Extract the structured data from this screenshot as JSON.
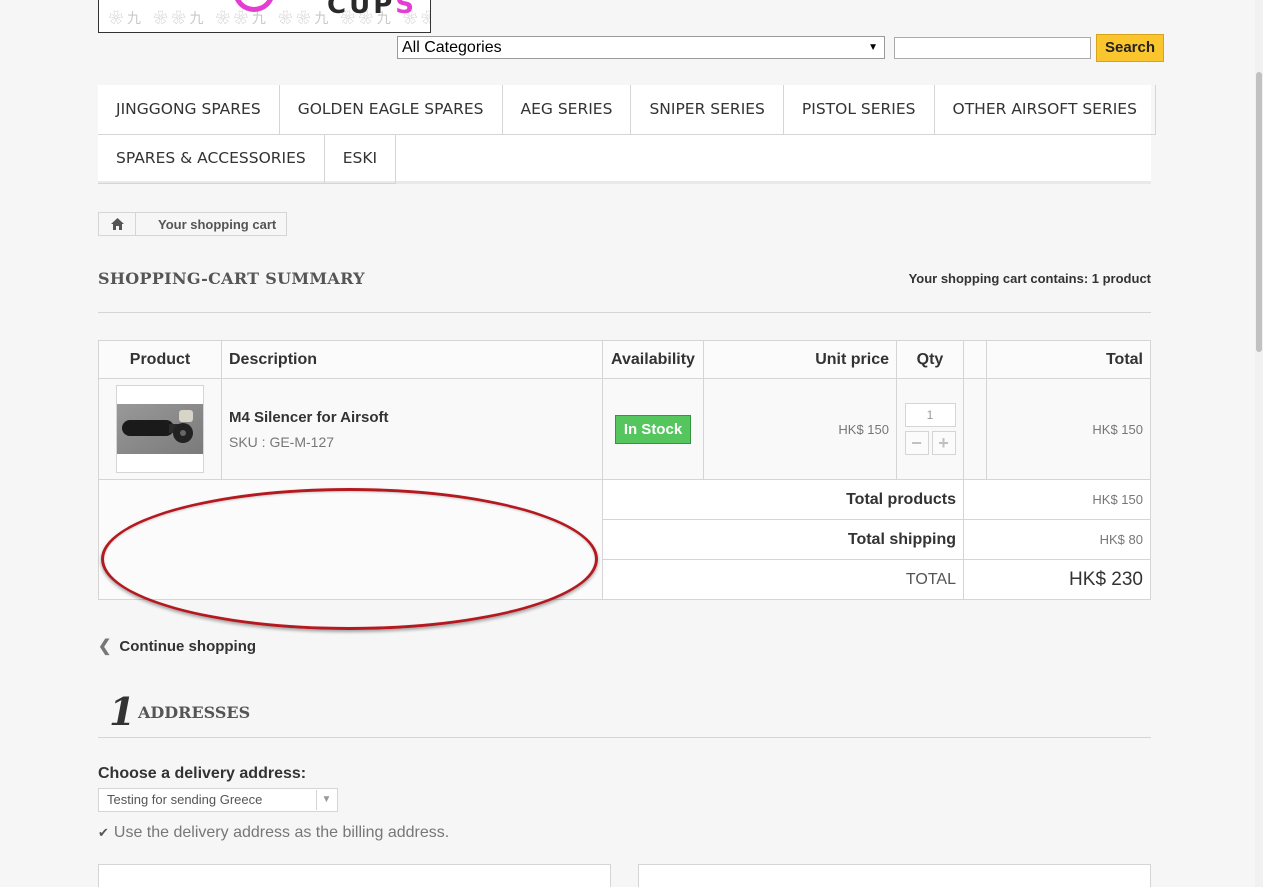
{
  "header": {
    "logo_text_1": "CUP",
    "logo_text_2": "S",
    "logo_pattern": "❀九 ❀❀九 ❀❀九 ❀❀九 ❀❀九 ❀❀九",
    "category_select": "All Categories",
    "search_placeholder": "",
    "search_button": "Search"
  },
  "menu": {
    "row1": [
      "JINGGONG SPARES",
      "GOLDEN EAGLE SPARES",
      "AEG SERIES",
      "SNIPER SERIES",
      "PISTOL SERIES",
      "OTHER AIRSOFT SERIES"
    ],
    "row2": [
      "SPARES & ACCESSORIES",
      "ESKI"
    ]
  },
  "breadcrumb": {
    "current": "Your shopping cart"
  },
  "page": {
    "heading": "SHOPPING-CART SUMMARY",
    "cart_count": "Your shopping cart contains: 1 product"
  },
  "cart": {
    "headers": {
      "product": "Product",
      "description": "Description",
      "availability": "Availability",
      "unit_price": "Unit price",
      "qty": "Qty",
      "total": "Total"
    },
    "item": {
      "name": "M4 Silencer for Airsoft",
      "sku": "SKU : GE-M-127",
      "availability": "In Stock",
      "unit_price": "HK$ 150",
      "qty": "1",
      "total": "HK$ 150"
    },
    "summary": {
      "total_products_label": "Total products",
      "total_products": "HK$ 150",
      "total_shipping_label": "Total shipping",
      "total_shipping": "HK$ 80",
      "total_label": "TOTAL",
      "total": "HK$ 230"
    },
    "colors": {
      "in_stock": "#55c65e",
      "annotation": "#b3191e"
    }
  },
  "continue_label": "Continue shopping",
  "step": {
    "number": "1",
    "title": "ADDRESSES"
  },
  "address": {
    "label": "Choose a delivery address:",
    "selected": "Testing for sending Greece",
    "billing_label": "Use the delivery address as the billing address."
  }
}
